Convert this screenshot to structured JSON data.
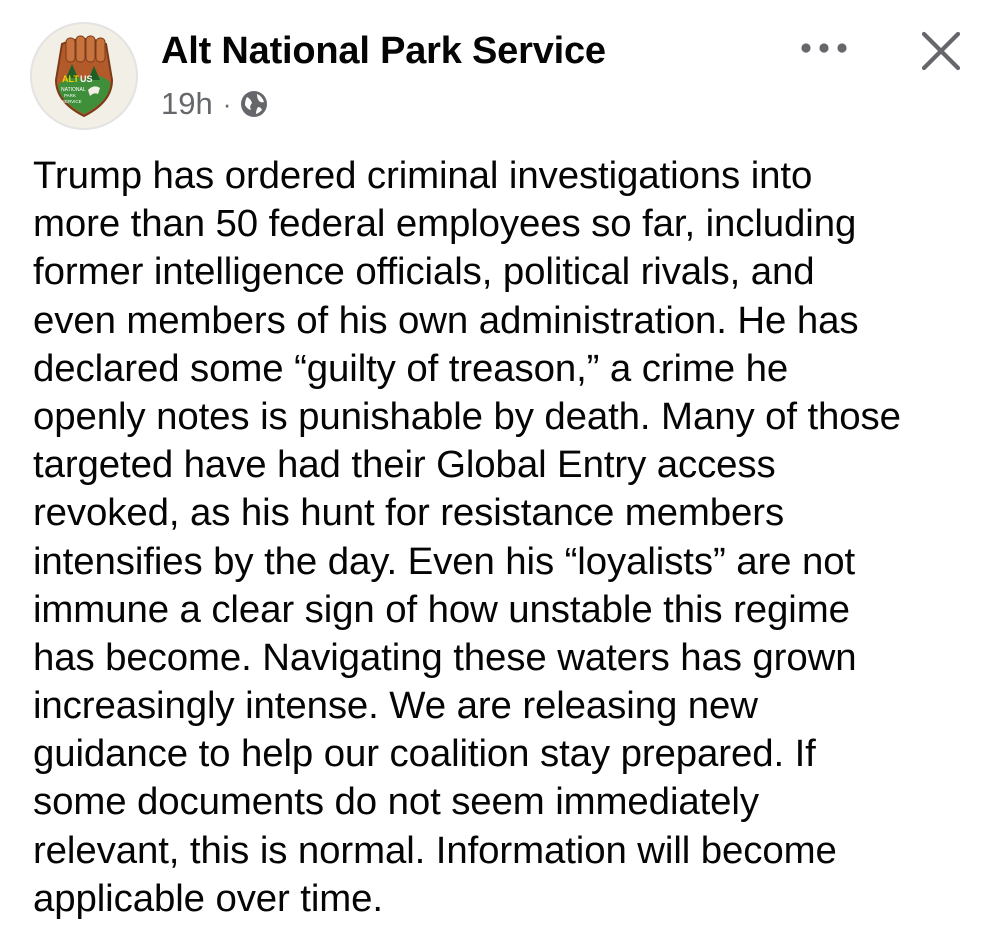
{
  "post": {
    "author": "Alt National Park Service",
    "timestamp": "19h",
    "separator": "·",
    "audience_icon": "globe-icon",
    "avatar": {
      "logo_text_alt": "ALT",
      "logo_text_us": "US",
      "logo_text_line1": "NATIONAL",
      "logo_text_line2": "PARK",
      "logo_text_line3": "SERVICE"
    },
    "more_icon": "more-options-icon",
    "close_icon": "close-icon",
    "body_lines": [
      "Trump has ordered criminal investigations into",
      "more than 50 federal employees so far, including",
      "former intelligence officials, political rivals, and",
      "even members of his own administration. He has",
      "declared some “guilty of treason,” a crime he",
      "openly notes is punishable by death. Many of those",
      "targeted have had their Global Entry access",
      "revoked, as his hunt for resistance members",
      "intensifies by the day. Even his “loyalists” are not",
      "immune a clear sign of how unstable this regime",
      "has become. Navigating these waters has grown",
      "increasingly intense. We are releasing new",
      "guidance to help our coalition stay prepared. If",
      "some documents do not seem immediately",
      "relevant, this is normal. Information will become",
      "applicable over time."
    ]
  },
  "colors": {
    "text_primary": "#050505",
    "text_secondary": "#65676b",
    "logo_brown": "#8a4a2a",
    "logo_green": "#2e7d32",
    "logo_orange": "#e8742a"
  }
}
